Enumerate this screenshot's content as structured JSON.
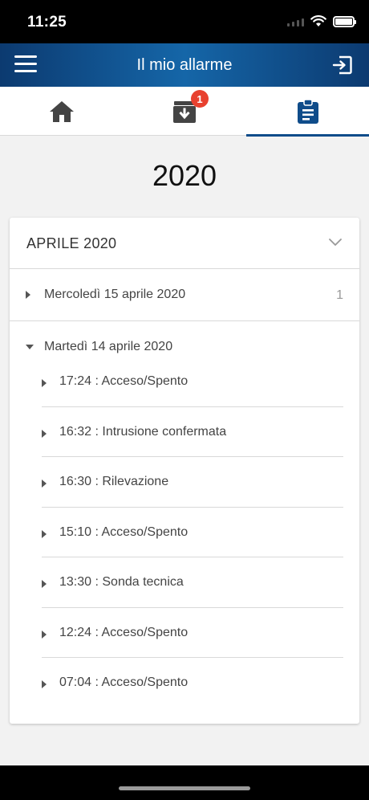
{
  "status": {
    "time": "11:25"
  },
  "header": {
    "title": "Il mio allarme",
    "menu_icon": "hamburger-icon",
    "logout_icon": "logout-icon"
  },
  "tabs": [
    {
      "icon": "home-icon",
      "active": false
    },
    {
      "icon": "archive-download-icon",
      "badge": "1",
      "active": false
    },
    {
      "icon": "clipboard-list-icon",
      "active": true
    }
  ],
  "year": "2020",
  "month": {
    "label": "APRILE 2020"
  },
  "days": [
    {
      "label": "Mercoledì 15 aprile 2020",
      "count": "1",
      "expanded": false
    },
    {
      "label": "Martedì 14 aprile 2020",
      "expanded": true,
      "events": [
        "17:24 : Acceso/Spento",
        "16:32 : Intrusione confermata",
        "16:30 : Rilevazione",
        "15:10 : Acceso/Spento",
        "13:30 : Sonda tecnica",
        "12:24 : Acceso/Spento",
        "07:04 : Acceso/Spento"
      ]
    }
  ],
  "colors": {
    "brand": "#0f4c8a",
    "badge": "#e8412f"
  }
}
